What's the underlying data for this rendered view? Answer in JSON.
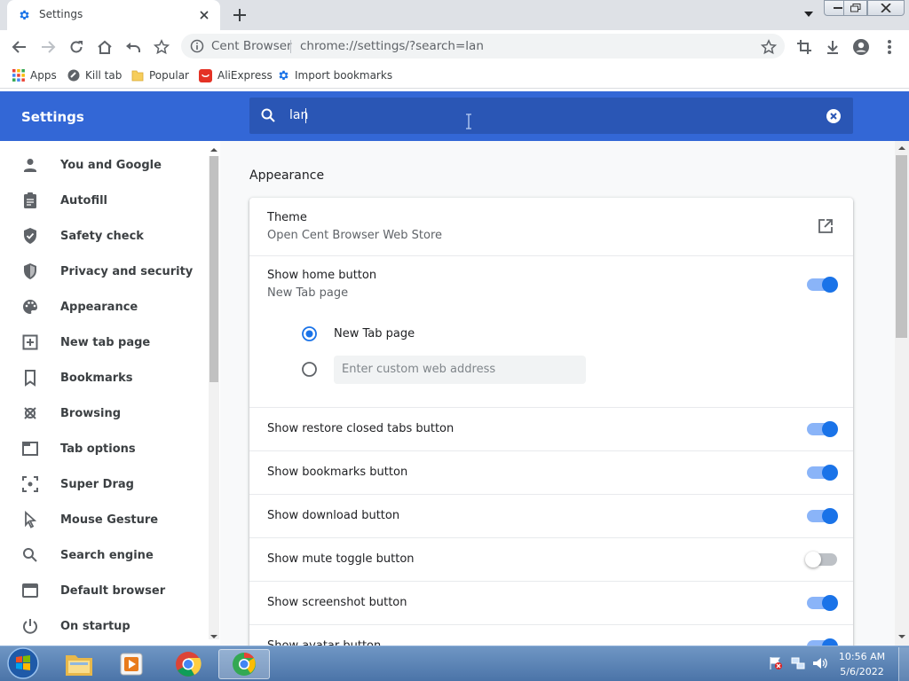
{
  "tab": {
    "title": "Settings",
    "icon": "gear-icon"
  },
  "toolbar": {
    "omnibox_brand": "Cent Browser",
    "url": "chrome://settings/?search=lan"
  },
  "bookmarks": [
    {
      "label": "Apps",
      "icon": "apps-grid-icon"
    },
    {
      "label": "Kill tab",
      "icon": "kill-tab-icon"
    },
    {
      "label": "Popular",
      "icon": "folder-icon"
    },
    {
      "label": "AliExpress",
      "icon": "aliexpress-icon"
    },
    {
      "label": "Import bookmarks",
      "icon": "gear-icon"
    }
  ],
  "header": {
    "title": "Settings",
    "search_value": "lan"
  },
  "sidebar": {
    "items": [
      {
        "label": "You and Google",
        "icon": "person-icon"
      },
      {
        "label": "Autofill",
        "icon": "clipboard-icon"
      },
      {
        "label": "Safety check",
        "icon": "shield-check-icon"
      },
      {
        "label": "Privacy and security",
        "icon": "shield-icon"
      },
      {
        "label": "Appearance",
        "icon": "palette-icon"
      },
      {
        "label": "New tab page",
        "icon": "new-tab-icon"
      },
      {
        "label": "Bookmarks",
        "icon": "bookmark-icon"
      },
      {
        "label": "Browsing",
        "icon": "browsing-icon"
      },
      {
        "label": "Tab options",
        "icon": "tab-icon"
      },
      {
        "label": "Super Drag",
        "icon": "super-drag-icon"
      },
      {
        "label": "Mouse Gesture",
        "icon": "cursor-icon"
      },
      {
        "label": "Search engine",
        "icon": "search-icon"
      },
      {
        "label": "Default browser",
        "icon": "browser-icon"
      },
      {
        "label": "On startup",
        "icon": "power-icon"
      }
    ]
  },
  "appearance": {
    "section_title": "Appearance",
    "theme_label": "Theme",
    "theme_sub": "Open Cent Browser Web Store",
    "home_label": "Show home button",
    "home_sub": "New Tab page",
    "home_enabled": true,
    "radio_newtab": "New Tab page",
    "custom_placeholder": "Enter custom web address",
    "toggles": [
      {
        "label": "Show restore closed tabs button",
        "on": true
      },
      {
        "label": "Show bookmarks button",
        "on": true
      },
      {
        "label": "Show download button",
        "on": true
      },
      {
        "label": "Show mute toggle button",
        "on": false
      },
      {
        "label": "Show screenshot button",
        "on": true
      },
      {
        "label": "Show avatar button",
        "on": true
      }
    ]
  },
  "taskbar": {
    "time": "10:56 AM",
    "date": "5/6/2022"
  },
  "colors": {
    "header_blue": "#3367d6",
    "accent": "#1a73e8"
  }
}
